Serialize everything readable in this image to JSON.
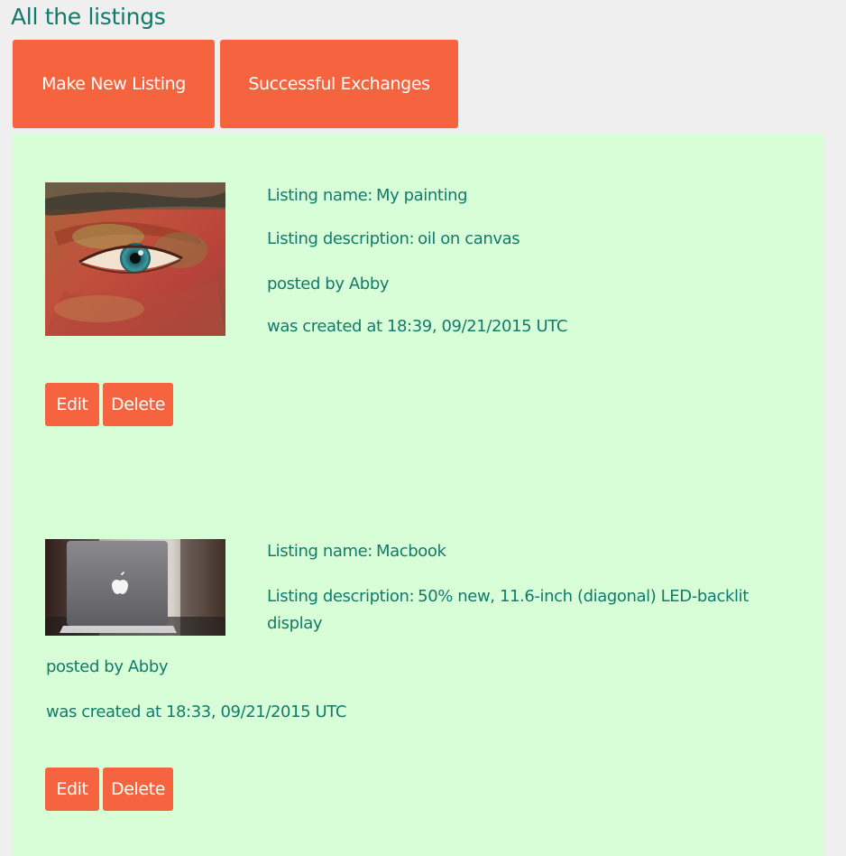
{
  "page": {
    "title": "All the listings"
  },
  "toolbar": {
    "new_listing_label": "Make New Listing",
    "exchanges_label": "Successful Exchanges"
  },
  "listings": [
    {
      "name_label": "Listing name:",
      "name": "My painting",
      "description_label": "Listing description:",
      "description": "oil on canvas",
      "posted_by": "posted by Abby",
      "created_at": "was created at 18:39, 09/21/2015 UTC",
      "edit_label": "Edit",
      "delete_label": "Delete",
      "image_icon": "eye-painting-image"
    },
    {
      "name_label": "Listing name:",
      "name": "Macbook",
      "description_label": "Listing description:",
      "description": "50% new, 11.6-inch (diagonal) LED-backlit display",
      "posted_by": "posted by Abby",
      "created_at": "was created at 18:33, 09/21/2015 UTC",
      "edit_label": "Edit",
      "delete_label": "Delete",
      "image_icon": "laptop-image"
    }
  ],
  "colors": {
    "accent": "#f5633f",
    "text": "#127a6a",
    "panel_bg": "#d8fed8",
    "page_bg": "#efefef"
  }
}
